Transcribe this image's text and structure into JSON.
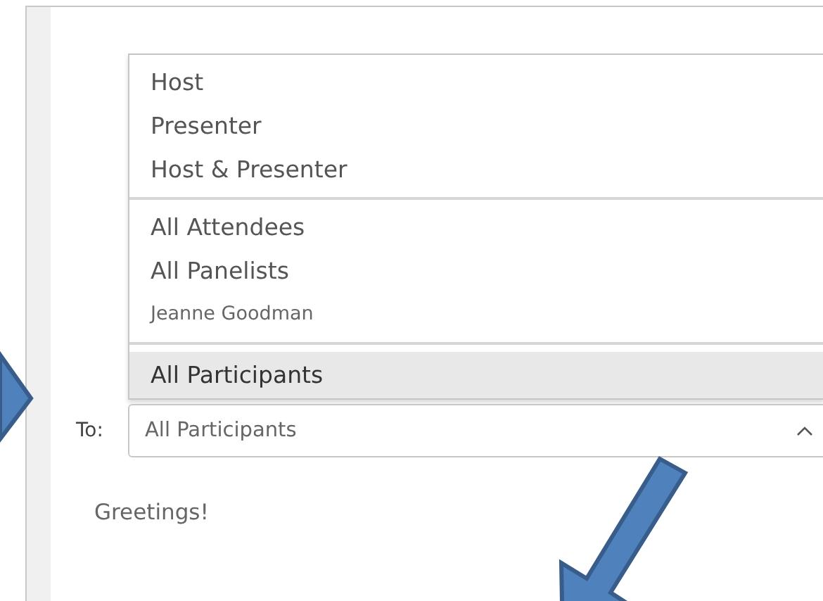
{
  "recipient_menu": {
    "groups": [
      {
        "items": [
          {
            "label": "Host",
            "kind": "role",
            "selected": false
          },
          {
            "label": "Presenter",
            "kind": "role",
            "selected": false
          },
          {
            "label": "Host & Presenter",
            "kind": "role",
            "selected": false
          }
        ]
      },
      {
        "items": [
          {
            "label": "All Attendees",
            "kind": "role",
            "selected": false
          },
          {
            "label": "All Panelists",
            "kind": "role",
            "selected": false
          },
          {
            "label": "Jeanne Goodman",
            "kind": "person",
            "selected": false
          }
        ]
      },
      {
        "items": [
          {
            "label": "All Participants",
            "kind": "role",
            "selected": true
          }
        ]
      }
    ]
  },
  "to_field": {
    "label": "To:",
    "value": "All Participants",
    "expanded": true
  },
  "message": "Greetings!"
}
